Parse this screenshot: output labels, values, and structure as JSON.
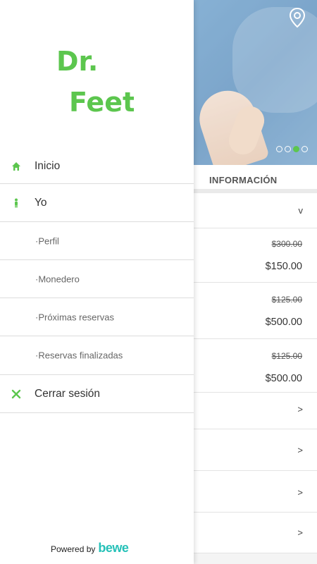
{
  "drawer": {
    "logo_text_line1": "Dr.",
    "logo_text_line2": "Feet",
    "menu": [
      {
        "label": "Inicio",
        "icon": "home-icon"
      },
      {
        "label": "Yo",
        "icon": "person-icon"
      },
      {
        "label": "·Perfil"
      },
      {
        "label": "·Monedero"
      },
      {
        "label": "·Próximas reservas"
      },
      {
        "label": "·Reservas finalizadas"
      },
      {
        "label": "Cerrar sesión",
        "icon": "close-icon"
      }
    ],
    "powered_by": "Powered by",
    "bewe_logo": "bewe"
  },
  "background": {
    "tab_label": "INFORMACIÓN",
    "dropdown_chevron": "v",
    "offers": [
      {
        "old_price": "$300.00",
        "new_price": "$150.00"
      },
      {
        "old_price": "$125.00",
        "new_price": "$500.00"
      },
      {
        "old_price": "$125.00",
        "new_price": "$500.00"
      }
    ],
    "row_chevron": ">"
  },
  "colors": {
    "accent_green": "#5cc64e",
    "bewe_teal": "#26c1b8"
  }
}
